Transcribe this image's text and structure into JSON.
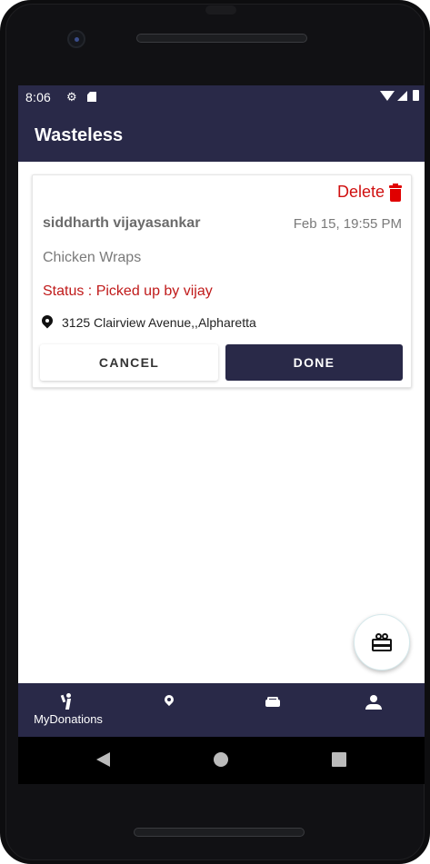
{
  "statusbar": {
    "time": "8:06",
    "left_icons": [
      "gear-icon",
      "sd-card-icon"
    ],
    "right_icons": [
      "wifi-icon",
      "signal-icon",
      "battery-icon"
    ]
  },
  "appbar": {
    "title": "Wasteless"
  },
  "donation_card": {
    "delete_label": "Delete",
    "donor_name": "siddharth vijayasankar",
    "date": "Feb 15, 19:55 PM",
    "item": "Chicken Wraps",
    "status": "Status : Picked up by vijay",
    "address": "3125 Clairview Avenue,,Alpharetta",
    "cancel_label": "CANCEL",
    "done_label": "DONE"
  },
  "fab": {
    "icon": "gift-icon"
  },
  "bottom_nav": {
    "items": [
      {
        "label": "MyDonations",
        "icon": "person-waving-icon"
      },
      {
        "label": "",
        "icon": "location-pin-icon"
      },
      {
        "label": "",
        "icon": "car-icon"
      },
      {
        "label": "",
        "icon": "person-icon"
      }
    ]
  },
  "system_nav": {
    "icons": [
      "back-icon",
      "home-icon",
      "recents-icon"
    ]
  },
  "colors": {
    "primary": "#292948",
    "status_red": "#c01a1a",
    "delete_red": "#e00000"
  }
}
